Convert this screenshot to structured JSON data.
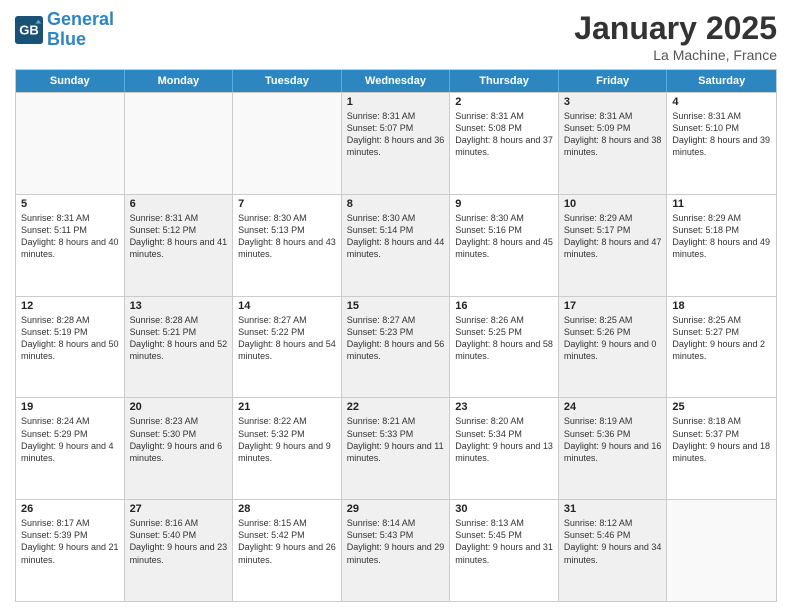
{
  "header": {
    "logo_line1": "General",
    "logo_line2": "Blue",
    "title": "January 2025",
    "subtitle": "La Machine, France"
  },
  "days_of_week": [
    "Sunday",
    "Monday",
    "Tuesday",
    "Wednesday",
    "Thursday",
    "Friday",
    "Saturday"
  ],
  "weeks": [
    [
      {
        "day": "",
        "sunrise": "",
        "sunset": "",
        "daylight": "",
        "shaded": false,
        "empty": true
      },
      {
        "day": "",
        "sunrise": "",
        "sunset": "",
        "daylight": "",
        "shaded": false,
        "empty": true
      },
      {
        "day": "",
        "sunrise": "",
        "sunset": "",
        "daylight": "",
        "shaded": false,
        "empty": true
      },
      {
        "day": "1",
        "sunrise": "Sunrise: 8:31 AM",
        "sunset": "Sunset: 5:07 PM",
        "daylight": "Daylight: 8 hours and 36 minutes.",
        "shaded": true,
        "empty": false
      },
      {
        "day": "2",
        "sunrise": "Sunrise: 8:31 AM",
        "sunset": "Sunset: 5:08 PM",
        "daylight": "Daylight: 8 hours and 37 minutes.",
        "shaded": false,
        "empty": false
      },
      {
        "day": "3",
        "sunrise": "Sunrise: 8:31 AM",
        "sunset": "Sunset: 5:09 PM",
        "daylight": "Daylight: 8 hours and 38 minutes.",
        "shaded": true,
        "empty": false
      },
      {
        "day": "4",
        "sunrise": "Sunrise: 8:31 AM",
        "sunset": "Sunset: 5:10 PM",
        "daylight": "Daylight: 8 hours and 39 minutes.",
        "shaded": false,
        "empty": false
      }
    ],
    [
      {
        "day": "5",
        "sunrise": "Sunrise: 8:31 AM",
        "sunset": "Sunset: 5:11 PM",
        "daylight": "Daylight: 8 hours and 40 minutes.",
        "shaded": false,
        "empty": false
      },
      {
        "day": "6",
        "sunrise": "Sunrise: 8:31 AM",
        "sunset": "Sunset: 5:12 PM",
        "daylight": "Daylight: 8 hours and 41 minutes.",
        "shaded": true,
        "empty": false
      },
      {
        "day": "7",
        "sunrise": "Sunrise: 8:30 AM",
        "sunset": "Sunset: 5:13 PM",
        "daylight": "Daylight: 8 hours and 43 minutes.",
        "shaded": false,
        "empty": false
      },
      {
        "day": "8",
        "sunrise": "Sunrise: 8:30 AM",
        "sunset": "Sunset: 5:14 PM",
        "daylight": "Daylight: 8 hours and 44 minutes.",
        "shaded": true,
        "empty": false
      },
      {
        "day": "9",
        "sunrise": "Sunrise: 8:30 AM",
        "sunset": "Sunset: 5:16 PM",
        "daylight": "Daylight: 8 hours and 45 minutes.",
        "shaded": false,
        "empty": false
      },
      {
        "day": "10",
        "sunrise": "Sunrise: 8:29 AM",
        "sunset": "Sunset: 5:17 PM",
        "daylight": "Daylight: 8 hours and 47 minutes.",
        "shaded": true,
        "empty": false
      },
      {
        "day": "11",
        "sunrise": "Sunrise: 8:29 AM",
        "sunset": "Sunset: 5:18 PM",
        "daylight": "Daylight: 8 hours and 49 minutes.",
        "shaded": false,
        "empty": false
      }
    ],
    [
      {
        "day": "12",
        "sunrise": "Sunrise: 8:28 AM",
        "sunset": "Sunset: 5:19 PM",
        "daylight": "Daylight: 8 hours and 50 minutes.",
        "shaded": false,
        "empty": false
      },
      {
        "day": "13",
        "sunrise": "Sunrise: 8:28 AM",
        "sunset": "Sunset: 5:21 PM",
        "daylight": "Daylight: 8 hours and 52 minutes.",
        "shaded": true,
        "empty": false
      },
      {
        "day": "14",
        "sunrise": "Sunrise: 8:27 AM",
        "sunset": "Sunset: 5:22 PM",
        "daylight": "Daylight: 8 hours and 54 minutes.",
        "shaded": false,
        "empty": false
      },
      {
        "day": "15",
        "sunrise": "Sunrise: 8:27 AM",
        "sunset": "Sunset: 5:23 PM",
        "daylight": "Daylight: 8 hours and 56 minutes.",
        "shaded": true,
        "empty": false
      },
      {
        "day": "16",
        "sunrise": "Sunrise: 8:26 AM",
        "sunset": "Sunset: 5:25 PM",
        "daylight": "Daylight: 8 hours and 58 minutes.",
        "shaded": false,
        "empty": false
      },
      {
        "day": "17",
        "sunrise": "Sunrise: 8:25 AM",
        "sunset": "Sunset: 5:26 PM",
        "daylight": "Daylight: 9 hours and 0 minutes.",
        "shaded": true,
        "empty": false
      },
      {
        "day": "18",
        "sunrise": "Sunrise: 8:25 AM",
        "sunset": "Sunset: 5:27 PM",
        "daylight": "Daylight: 9 hours and 2 minutes.",
        "shaded": false,
        "empty": false
      }
    ],
    [
      {
        "day": "19",
        "sunrise": "Sunrise: 8:24 AM",
        "sunset": "Sunset: 5:29 PM",
        "daylight": "Daylight: 9 hours and 4 minutes.",
        "shaded": false,
        "empty": false
      },
      {
        "day": "20",
        "sunrise": "Sunrise: 8:23 AM",
        "sunset": "Sunset: 5:30 PM",
        "daylight": "Daylight: 9 hours and 6 minutes.",
        "shaded": true,
        "empty": false
      },
      {
        "day": "21",
        "sunrise": "Sunrise: 8:22 AM",
        "sunset": "Sunset: 5:32 PM",
        "daylight": "Daylight: 9 hours and 9 minutes.",
        "shaded": false,
        "empty": false
      },
      {
        "day": "22",
        "sunrise": "Sunrise: 8:21 AM",
        "sunset": "Sunset: 5:33 PM",
        "daylight": "Daylight: 9 hours and 11 minutes.",
        "shaded": true,
        "empty": false
      },
      {
        "day": "23",
        "sunrise": "Sunrise: 8:20 AM",
        "sunset": "Sunset: 5:34 PM",
        "daylight": "Daylight: 9 hours and 13 minutes.",
        "shaded": false,
        "empty": false
      },
      {
        "day": "24",
        "sunrise": "Sunrise: 8:19 AM",
        "sunset": "Sunset: 5:36 PM",
        "daylight": "Daylight: 9 hours and 16 minutes.",
        "shaded": true,
        "empty": false
      },
      {
        "day": "25",
        "sunrise": "Sunrise: 8:18 AM",
        "sunset": "Sunset: 5:37 PM",
        "daylight": "Daylight: 9 hours and 18 minutes.",
        "shaded": false,
        "empty": false
      }
    ],
    [
      {
        "day": "26",
        "sunrise": "Sunrise: 8:17 AM",
        "sunset": "Sunset: 5:39 PM",
        "daylight": "Daylight: 9 hours and 21 minutes.",
        "shaded": false,
        "empty": false
      },
      {
        "day": "27",
        "sunrise": "Sunrise: 8:16 AM",
        "sunset": "Sunset: 5:40 PM",
        "daylight": "Daylight: 9 hours and 23 minutes.",
        "shaded": true,
        "empty": false
      },
      {
        "day": "28",
        "sunrise": "Sunrise: 8:15 AM",
        "sunset": "Sunset: 5:42 PM",
        "daylight": "Daylight: 9 hours and 26 minutes.",
        "shaded": false,
        "empty": false
      },
      {
        "day": "29",
        "sunrise": "Sunrise: 8:14 AM",
        "sunset": "Sunset: 5:43 PM",
        "daylight": "Daylight: 9 hours and 29 minutes.",
        "shaded": true,
        "empty": false
      },
      {
        "day": "30",
        "sunrise": "Sunrise: 8:13 AM",
        "sunset": "Sunset: 5:45 PM",
        "daylight": "Daylight: 9 hours and 31 minutes.",
        "shaded": false,
        "empty": false
      },
      {
        "day": "31",
        "sunrise": "Sunrise: 8:12 AM",
        "sunset": "Sunset: 5:46 PM",
        "daylight": "Daylight: 9 hours and 34 minutes.",
        "shaded": true,
        "empty": false
      },
      {
        "day": "",
        "sunrise": "",
        "sunset": "",
        "daylight": "",
        "shaded": false,
        "empty": true
      }
    ]
  ]
}
